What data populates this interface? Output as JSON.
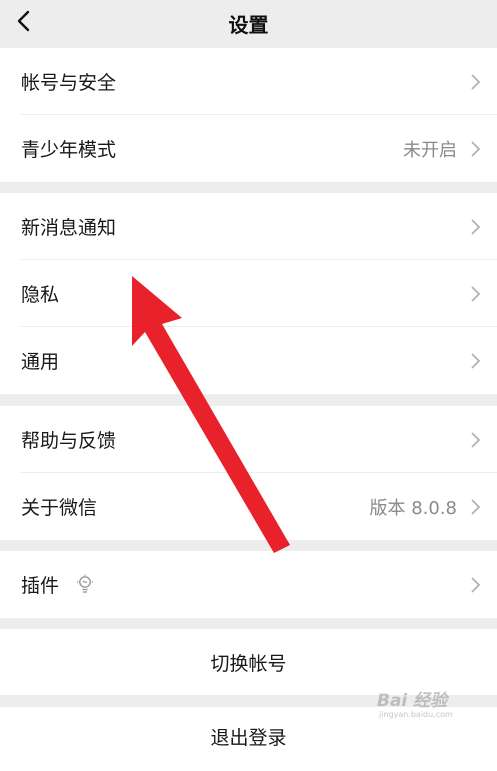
{
  "nav": {
    "title": "设置"
  },
  "groups": [
    {
      "rows": [
        {
          "label": "帐号与安全"
        },
        {
          "label": "青少年模式",
          "value": "未开启"
        }
      ]
    },
    {
      "rows": [
        {
          "label": "新消息通知"
        },
        {
          "label": "隐私"
        },
        {
          "label": "通用"
        }
      ]
    },
    {
      "rows": [
        {
          "label": "帮助与反馈"
        },
        {
          "label": "关于微信",
          "value": "版本 8.0.8"
        }
      ]
    },
    {
      "rows": [
        {
          "label": "插件"
        }
      ]
    }
  ],
  "actions": {
    "switch_account": "切换帐号",
    "logout": "退出登录"
  },
  "annotation": {
    "color": "#e8212a"
  },
  "watermark": {
    "main": "Bai 经验",
    "sub": "jingyan.baidu.com"
  }
}
